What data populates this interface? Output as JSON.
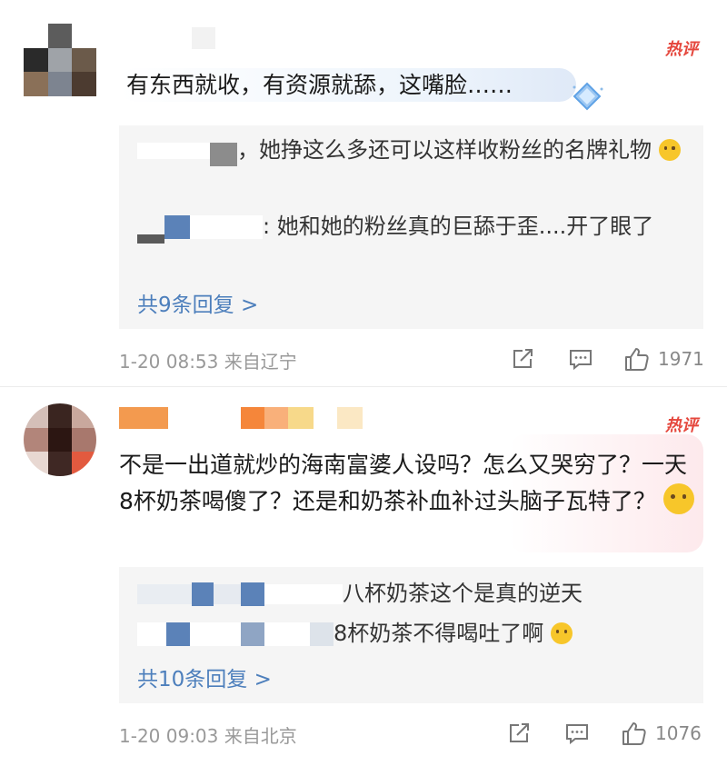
{
  "hot_label": "热评",
  "comments": [
    {
      "text": "有东西就收，有资源就舔，这嘴脸……",
      "replies": [
        {
          "text": "，她挣这么多还可以这样收粉丝的名牌礼物"
        },
        {
          "text": ": 她和她的粉丝真的巨舔于歪....开了眼了"
        }
      ],
      "more_replies": "共9条回复 >",
      "time": "1-20 08:53",
      "location": "来自辽宁",
      "likes": "1971"
    },
    {
      "text": "不是一出道就炒的海南富婆人设吗？怎么又哭穷了？一天8杯奶茶喝傻了？还是和奶茶补血补过头脑子瓦特了？",
      "replies": [
        {
          "text": "八杯奶茶这个是真的逆天"
        },
        {
          "text": "8杯奶茶不得喝吐了啊"
        }
      ],
      "more_replies": "共10条回复 >",
      "time": "1-20 09:03",
      "location": "来自北京",
      "likes": "1076"
    }
  ],
  "icons": [
    "share-icon",
    "comment-icon",
    "like-icon",
    "cry-emoji-icon",
    "dizzy-emoji-icon",
    "gem-badge-icon"
  ],
  "colors": {
    "hot": "#e5473d",
    "link": "#4d7fbc",
    "reply_bg": "#f5f5f5",
    "meta": "#999999"
  }
}
